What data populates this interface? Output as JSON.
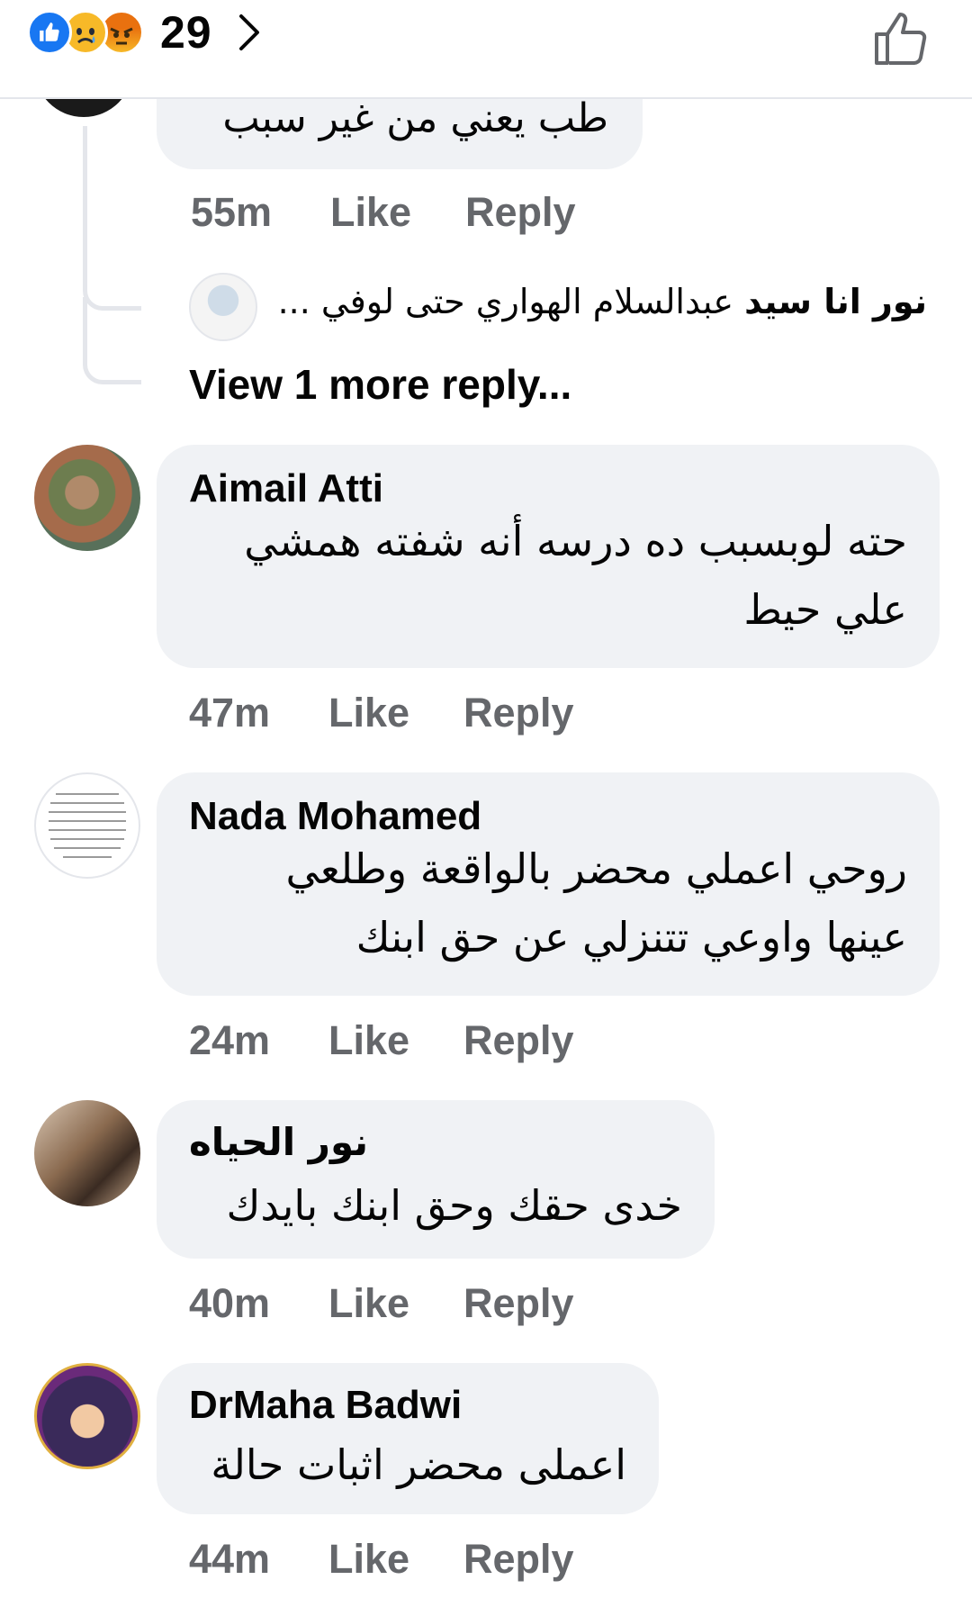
{
  "header": {
    "reactions": [
      "like-icon",
      "sad-icon",
      "angry-icon"
    ],
    "reaction_count": "29"
  },
  "colors": {
    "like_blue": "#1877f2",
    "bubble_gray": "#f0f2f5",
    "meta_gray": "#65676b",
    "text": "#050505"
  },
  "partial_comment": {
    "text": "طب يعني من غير سبب",
    "time": "55m",
    "like": "Like",
    "reply": "Reply"
  },
  "reply_preview": {
    "author": "نور انا سيد",
    "text": "عبدالسلام الهواري حتى لوفي ..."
  },
  "view_more": "View 1 more reply...",
  "comments": [
    {
      "author": "Aimail Atti",
      "lines": [
        "حته لوبسبب ده درسه أنه شفته همشي",
        "علي حيط"
      ],
      "time": "47m",
      "like": "Like",
      "reply": "Reply"
    },
    {
      "author": "Nada Mohamed",
      "lines": [
        "روحي اعملي محضر بالواقعة وطلعي",
        "عينها واوعي تتنزلي عن حق ابنك"
      ],
      "time": "24m",
      "like": "Like",
      "reply": "Reply"
    },
    {
      "author": "نور الحياه",
      "lines": [
        "خدى حقك وحق ابنك بايدك"
      ],
      "time": "40m",
      "like": "Like",
      "reply": "Reply"
    },
    {
      "author": "DrMaha Badwi",
      "lines": [
        "اعملى محضر اثبات حالة"
      ],
      "time": "44m",
      "like": "Like",
      "reply": "Reply"
    }
  ]
}
